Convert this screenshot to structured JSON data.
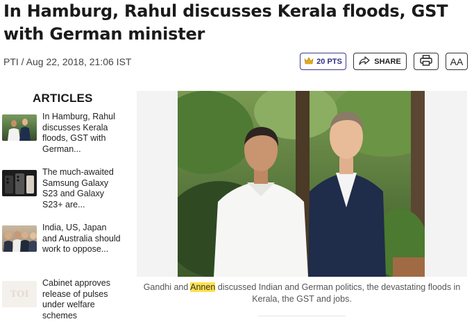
{
  "article": {
    "headline": "In Hamburg, Rahul discusses Kerala floods, GST with German minister",
    "byline": "PTI / Aug 22, 2018, 21:06 IST"
  },
  "actions": {
    "points_label": "20 PTS",
    "share_label": "SHARE",
    "font_size_label": "AA",
    "icons": [
      "crown-icon",
      "share-arrow-icon",
      "printer-icon"
    ]
  },
  "sidebar": {
    "title": "ARTICLES",
    "items": [
      {
        "label": "In Hamburg, Rahul discusses Kerala floods, GST with German..."
      },
      {
        "label": "The much-awaited Samsung Galaxy S23 and Galaxy S23+ are..."
      },
      {
        "label": "India, US, Japan and Australia should work to oppose..."
      },
      {
        "label": "Cabinet approves release of pulses under welfare schemes",
        "thumb_text": "TOI"
      }
    ]
  },
  "photo": {
    "caption_before": "Gandhi and ",
    "caption_highlight": "Annen",
    "caption_after": " discussed Indian and German politics, the devastating floods in Kerala, the GST and jobs."
  },
  "colors": {
    "points_accent": "#2d2d8a",
    "highlight": "#ffe14d"
  }
}
